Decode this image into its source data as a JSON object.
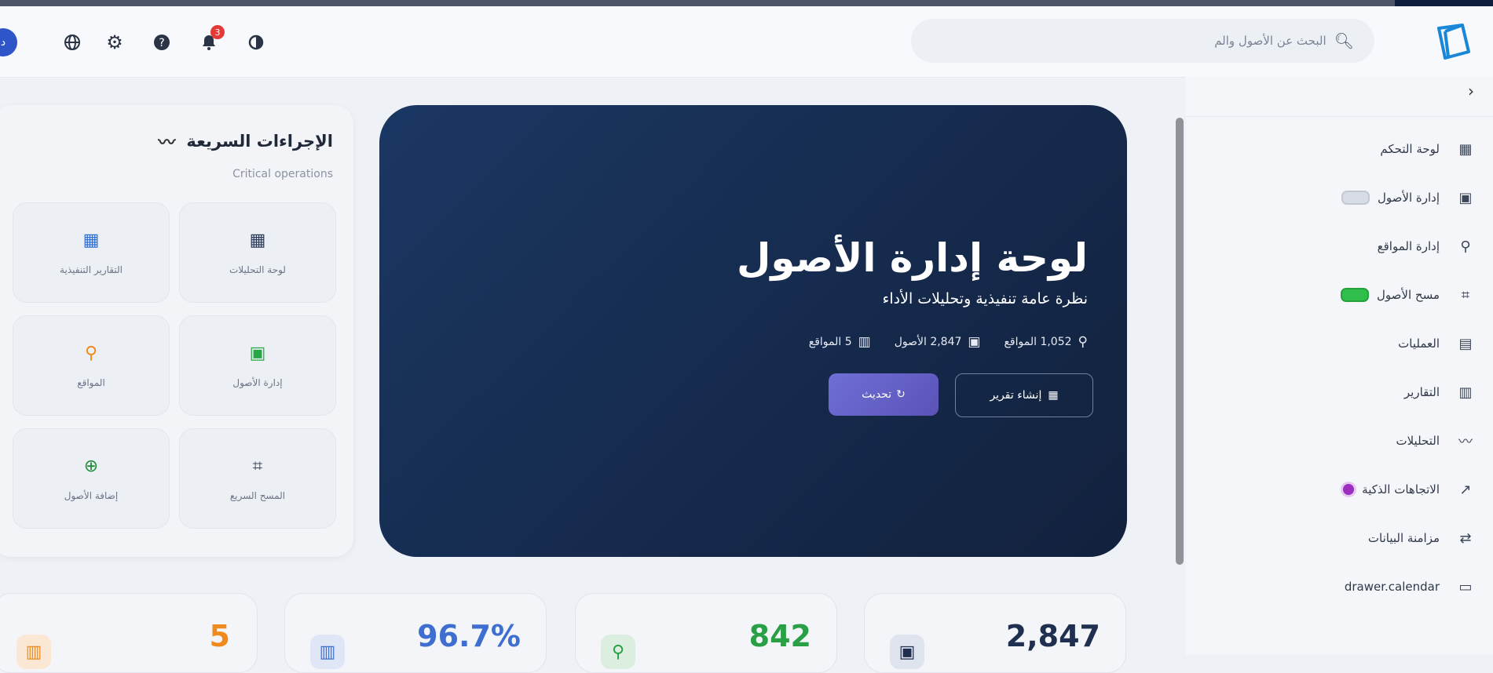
{
  "topbar": {
    "search_placeholder": "البحث عن الأصول والم",
    "notifications_count": "3",
    "avatar_initial": "د",
    "icons": [
      "globe-icon",
      "gear-icon",
      "help-icon",
      "bell-icon",
      "theme-toggle-icon"
    ]
  },
  "sidebar": {
    "collapse_label": "›",
    "items": [
      {
        "label": "لوحة التحكم",
        "icon": "dashboard-icon"
      },
      {
        "label": "إدارة الأصول",
        "icon": "box-icon",
        "pill": "gray"
      },
      {
        "label": "إدارة المواقع",
        "icon": "location-icon"
      },
      {
        "label": "مسح الأصول",
        "icon": "scan-icon",
        "pill": "green"
      },
      {
        "label": "العمليات",
        "icon": "clipboard-icon"
      },
      {
        "label": "التقارير",
        "icon": "report-icon"
      },
      {
        "label": "التحليلات",
        "icon": "trend-icon"
      },
      {
        "label": "الاتجاهات الذكية",
        "icon": "trend-up-icon",
        "dot": "purple"
      },
      {
        "label": "مزامنة البيانات",
        "icon": "sync-icon"
      },
      {
        "label": "drawer.calendar",
        "icon": "calendar-icon"
      }
    ]
  },
  "hero": {
    "title": "لوحة إدارة الأصول",
    "subtitle": "نظرة عامة تنفيذية وتحليلات الأداء",
    "stats": [
      "5 المواقع",
      "2,847 الأصول",
      "1,052 المواقع"
    ],
    "report_button": "إنشاء تقرير",
    "refresh_button": "تحديث"
  },
  "quick_actions": {
    "title": "الإجراءات السريعة",
    "subtitle": "Critical operations",
    "tiles": [
      {
        "label": "لوحة التحليلات",
        "icon": "analytics-icon",
        "color": "#2a3a5a"
      },
      {
        "label": "التقارير التنفيذية",
        "icon": "report-chart-icon",
        "color": "#2f6fd8"
      },
      {
        "label": "إدارة الأصول",
        "icon": "box-icon",
        "color": "#27a745"
      },
      {
        "label": "المواقع",
        "icon": "location-icon",
        "color": "#f08a1c"
      },
      {
        "label": "المسح السريع",
        "icon": "scan-icon",
        "color": "#3a4458"
      },
      {
        "label": "إضافة الأصول",
        "icon": "add-icon",
        "color": "#1f8a3a"
      }
    ]
  },
  "stats_cards": [
    {
      "value": "2,847",
      "color": "#1f2f4f",
      "icon": "box-icon"
    },
    {
      "value": "842",
      "color": "#2aa046",
      "icon": "location-icon"
    },
    {
      "value": "96.7%",
      "color": "#3e6fd0",
      "icon": "chart-icon"
    },
    {
      "value": "5",
      "color": "#f08a1c",
      "icon": "building-icon"
    }
  ]
}
